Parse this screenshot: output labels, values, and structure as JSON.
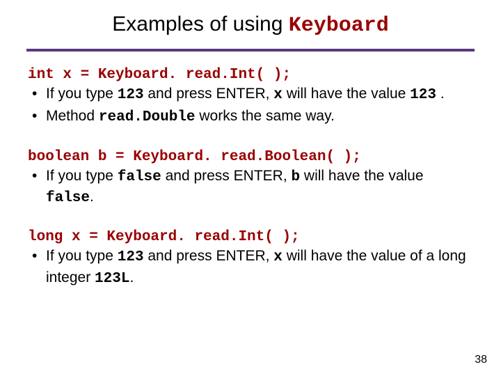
{
  "title": {
    "prefix": "Examples of using ",
    "mono": "Keyboard"
  },
  "blocks": [
    {
      "code": "int x = Keyboard. read.Int( );",
      "bullets": [
        {
          "segments": [
            {
              "t": "If you type "
            },
            {
              "t": "123",
              "mono": true
            },
            {
              "t": " and press ENTER, "
            },
            {
              "t": "x",
              "mono": true
            },
            {
              "t": " will have the value "
            },
            {
              "t": "123",
              "mono": true
            },
            {
              "t": " ."
            }
          ]
        },
        {
          "segments": [
            {
              "t": "Method "
            },
            {
              "t": "read.Double",
              "mono": true
            },
            {
              "t": " works the same way."
            }
          ]
        }
      ]
    },
    {
      "code": "boolean b = Keyboard. read.Boolean( );",
      "bullets": [
        {
          "segments": [
            {
              "t": "If you type "
            },
            {
              "t": "false",
              "mono": true
            },
            {
              "t": " and press ENTER, "
            },
            {
              "t": "b",
              "mono": true
            },
            {
              "t": " will have the value "
            },
            {
              "t": "false",
              "mono": true
            },
            {
              "t": "."
            }
          ]
        }
      ]
    },
    {
      "code": "long x = Keyboard. read.Int( );",
      "bullets": [
        {
          "segments": [
            {
              "t": "If you type "
            },
            {
              "t": "123",
              "mono": true
            },
            {
              "t": " and press ENTER, "
            },
            {
              "t": "x",
              "mono": true
            },
            {
              "t": " will have the value of a long integer "
            },
            {
              "t": "123L",
              "mono": true
            },
            {
              "t": "."
            }
          ]
        }
      ]
    }
  ],
  "page_number": "38"
}
